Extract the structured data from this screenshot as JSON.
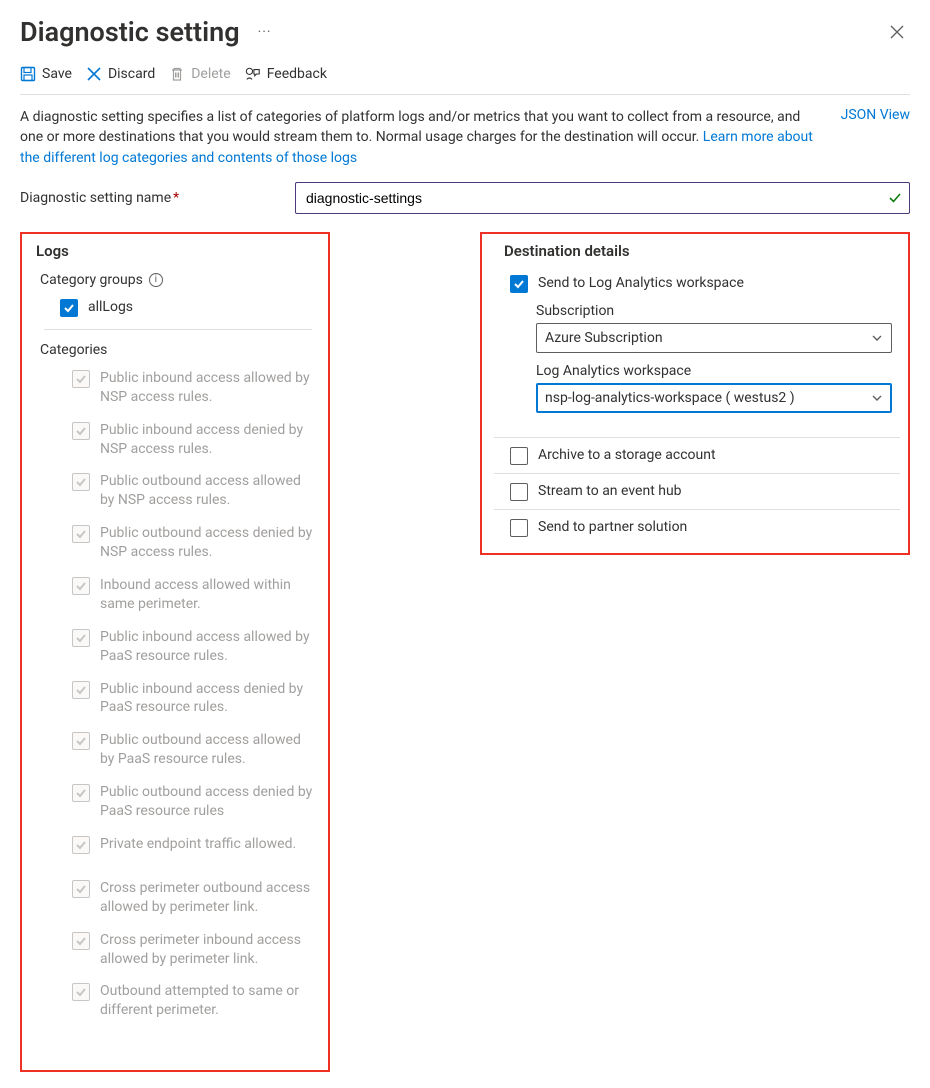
{
  "header": {
    "title": "Diagnostic setting"
  },
  "toolbar": {
    "save_label": "Save",
    "discard_label": "Discard",
    "delete_label": "Delete",
    "feedback_label": "Feedback"
  },
  "description": {
    "text": "A diagnostic setting specifies a list of categories of platform logs and/or metrics that you want to collect from a resource, and one or more destinations that you would stream them to. Normal usage charges for the destination will occur. ",
    "learn_more": "Learn more about the different log categories and contents of those logs",
    "json_view": "JSON View"
  },
  "name_field": {
    "label": "Diagnostic setting name",
    "value": "diagnostic-settings"
  },
  "logs_panel": {
    "title": "Logs",
    "category_groups_label": "Category groups",
    "all_logs_label": "allLogs",
    "categories_label": "Categories",
    "categories": [
      "Public inbound access allowed by NSP access rules.",
      "Public inbound access denied by NSP access rules.",
      "Public outbound access allowed by NSP access rules.",
      "Public outbound access denied by NSP access rules.",
      "Inbound access allowed within same perimeter.",
      "Public inbound access allowed by PaaS resource rules.",
      "Public inbound access denied by PaaS resource rules.",
      "Public outbound access allowed by PaaS resource rules.",
      "Public outbound access denied by PaaS resource rules",
      "Private endpoint traffic allowed.",
      "Cross perimeter outbound access allowed by perimeter link.",
      "Cross perimeter inbound access allowed by perimeter link.",
      "Outbound attempted to same or different perimeter."
    ]
  },
  "destination_panel": {
    "title": "Destination details",
    "send_law_label": "Send to Log Analytics workspace",
    "subscription_label": "Subscription",
    "subscription_value": "Azure Subscription",
    "law_label": "Log Analytics workspace",
    "law_value": "nsp-log-analytics-workspace ( westus2 )",
    "archive_label": "Archive to a storage account",
    "eventhub_label": "Stream to an event hub",
    "partner_label": "Send to partner solution"
  }
}
